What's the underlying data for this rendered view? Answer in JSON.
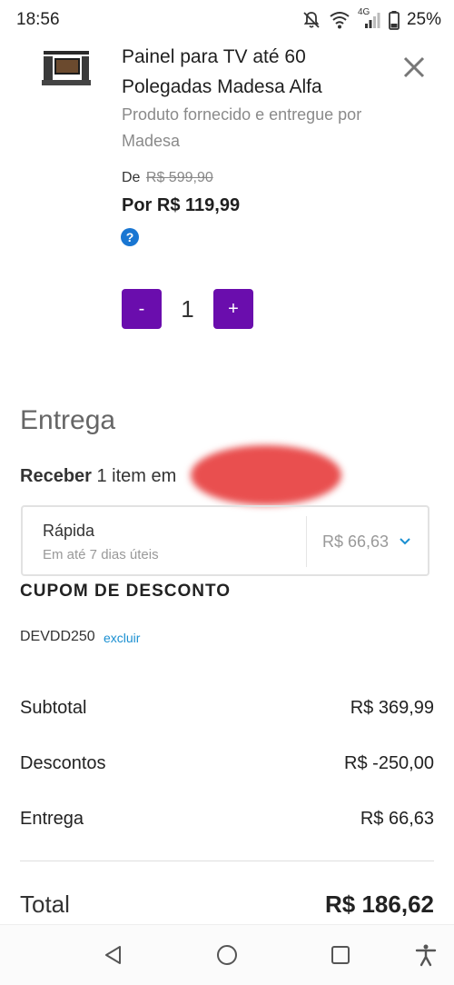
{
  "status_bar": {
    "time": "18:56",
    "network": "4G",
    "battery": "25%"
  },
  "product": {
    "title": "Painel para TV até 60 Polegadas Madesa Alfa",
    "supplier": "Produto fornecido e entregue por Madesa",
    "old_price_prefix": "De",
    "old_price": "R$ 599,90",
    "new_price": "Por R$ 119,99",
    "help_symbol": "?",
    "quantity": "1",
    "minus_label": "-",
    "plus_label": "+"
  },
  "delivery": {
    "heading": "Entrega",
    "receive_bold": "Receber",
    "receive_text": "1 item em",
    "option_name": "Rápida",
    "option_eta": "Em até 7 dias úteis",
    "option_price": "R$ 66,63"
  },
  "coupon": {
    "heading": "CUPOM DE DESCONTO",
    "code": "DEVDD250",
    "remove_label": "excluir"
  },
  "summary": {
    "subtotal_label": "Subtotal",
    "subtotal_value": "R$ 369,99",
    "discounts_label": "Descontos",
    "discounts_value": "R$ -250,00",
    "shipping_label": "Entrega",
    "shipping_value": "R$ 66,63",
    "total_label": "Total",
    "total_value": "R$ 186,62"
  },
  "icons": {
    "close": "close-icon",
    "help": "help-icon",
    "chevron": "chevron-down-icon",
    "nav_back": "back-icon",
    "nav_home": "home-icon",
    "nav_recents": "recents-icon",
    "accessibility": "accessibility-icon"
  },
  "colors": {
    "accent": "#6a0dad",
    "link": "#1a8fd1",
    "help": "#1976d2"
  }
}
